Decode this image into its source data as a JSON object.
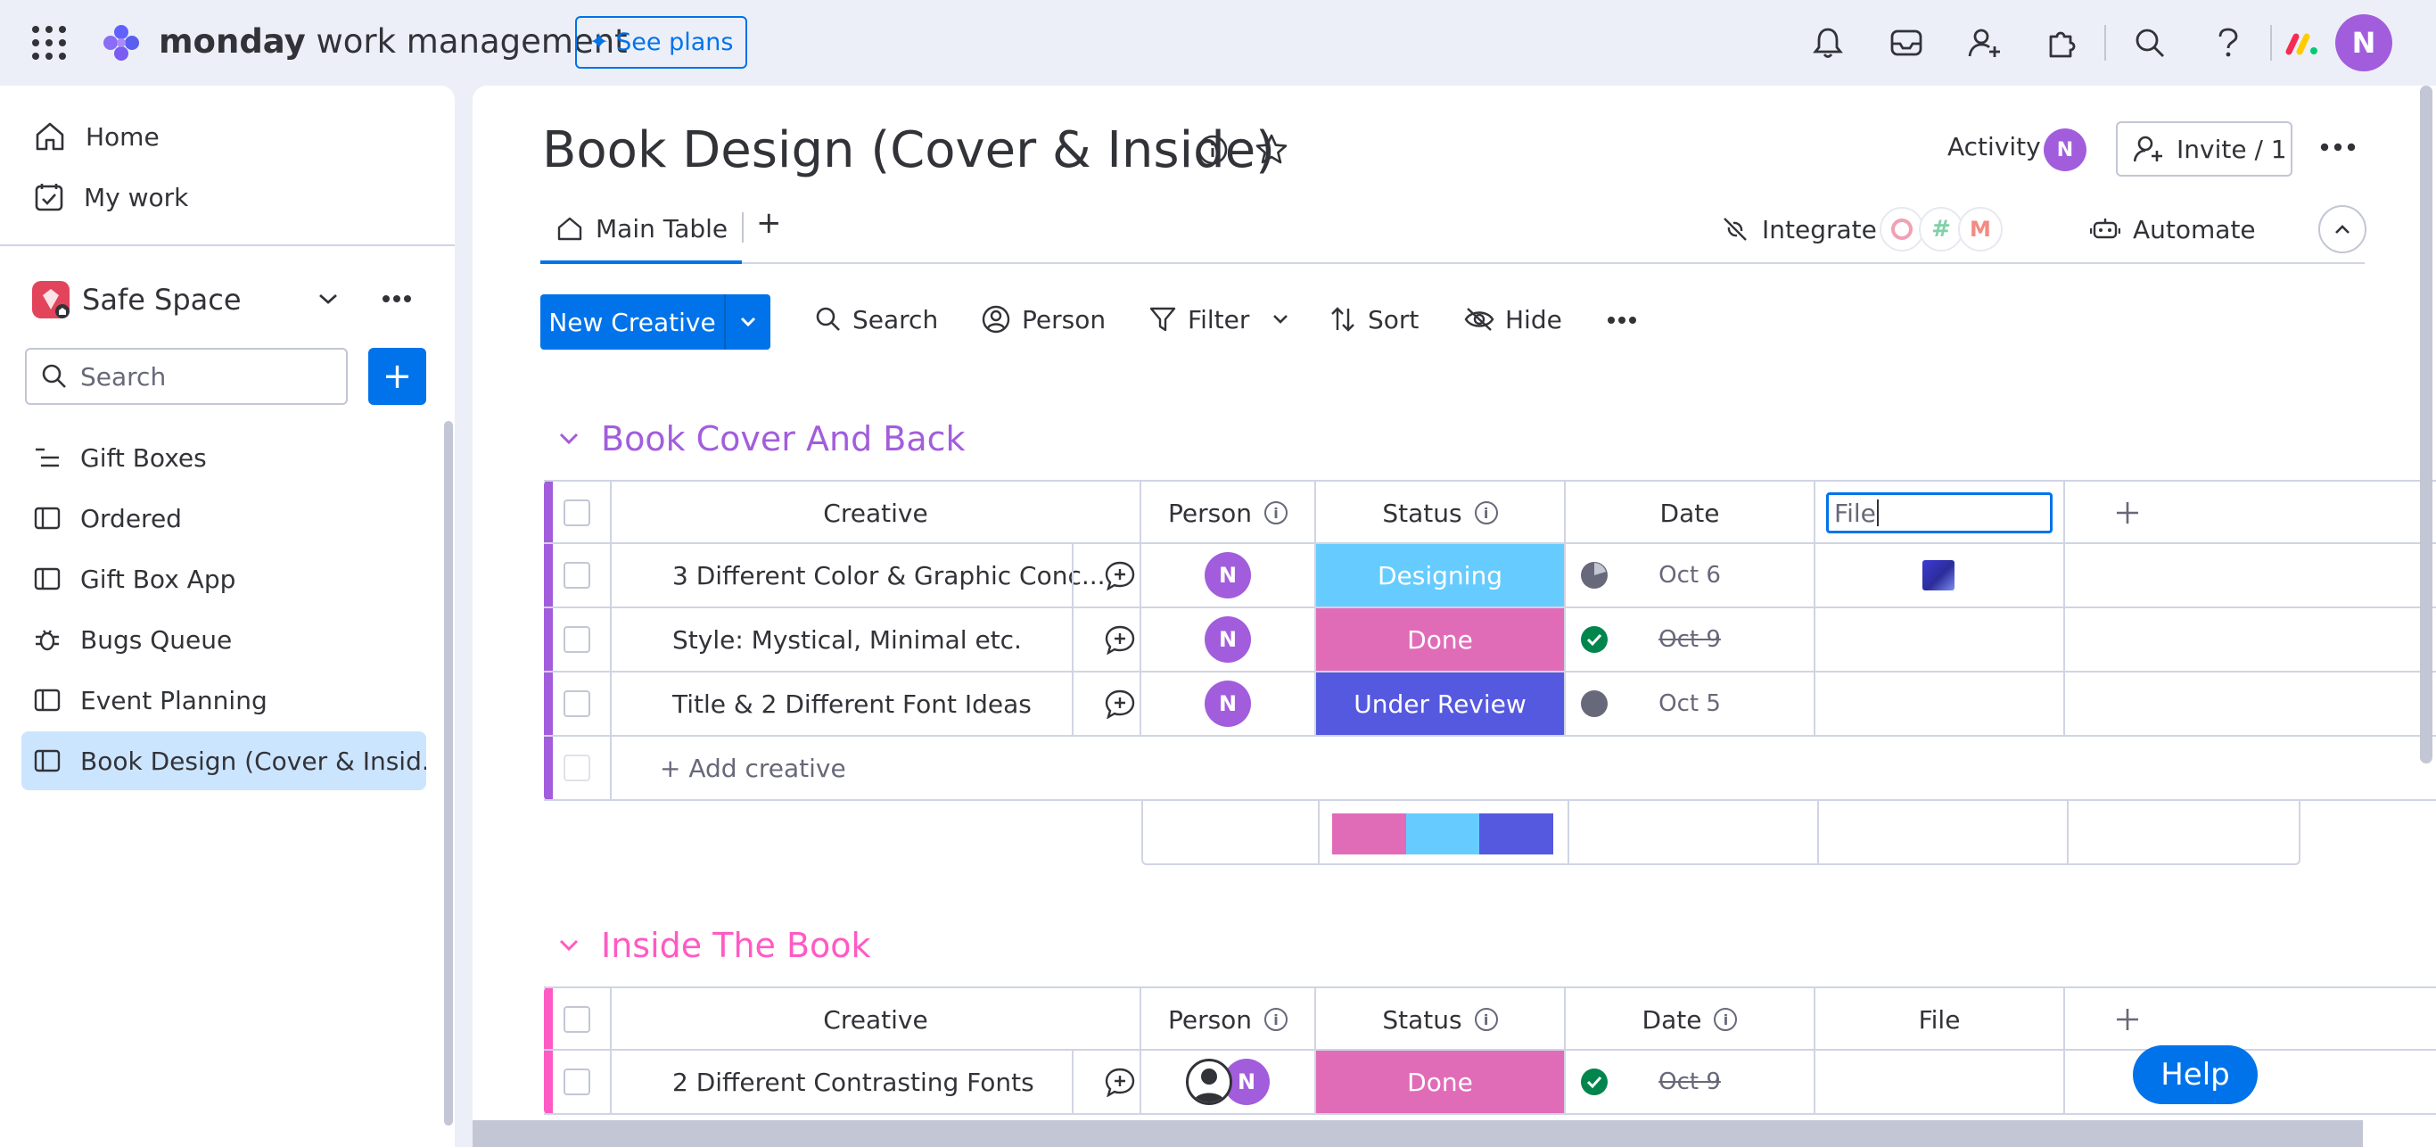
{
  "app": {
    "brand_bold": "monday",
    "brand_rest": " work management",
    "see_plans": "See plans",
    "user_initial": "N"
  },
  "sidebar": {
    "items": [
      {
        "label": "Home",
        "icon": "home-icon"
      },
      {
        "label": "My work",
        "icon": "my-work-icon"
      }
    ],
    "workspace": "Safe Space",
    "search_placeholder": "Search",
    "boards": [
      {
        "label": "Gift Boxes",
        "icon": "list-icon"
      },
      {
        "label": "Ordered",
        "icon": "board-icon"
      },
      {
        "label": "Gift Box App",
        "icon": "board-icon"
      },
      {
        "label": "Bugs Queue",
        "icon": "bug-icon"
      },
      {
        "label": "Event Planning",
        "icon": "board-icon"
      },
      {
        "label": "Book Design (Cover & Insid...",
        "icon": "board-icon",
        "active": true
      }
    ]
  },
  "board": {
    "title": "Book Design (Cover & Inside)",
    "activity": "Activity",
    "invite": "Invite / 1",
    "tab": "Main Table",
    "integrate": "Integrate",
    "automate": "Automate"
  },
  "toolbar": {
    "new_item": "New Creative",
    "search": "Search",
    "person": "Person",
    "filter": "Filter",
    "sort": "Sort",
    "hide": "Hide"
  },
  "colors": {
    "group1": "#a25ddc",
    "group2": "#ff5ac4",
    "designing": "#66ccff",
    "done": "#e06cb8",
    "under_review": "#5559df",
    "accent": "#0073ea"
  },
  "groups": [
    {
      "title": "Book Cover And Back",
      "columns": {
        "name": "Creative",
        "person": "Person",
        "status": "Status",
        "date": "Date",
        "file": "File"
      },
      "rows": [
        {
          "name": "3 Different Color & Graphic Conc...",
          "person": "N",
          "status": "Designing",
          "date": "Oct 6"
        },
        {
          "name": "Style: Mystical, Minimal etc.",
          "person": "N",
          "status": "Done",
          "date": "Oct 9"
        },
        {
          "name": "Title & 2 Different Font Ideas",
          "person": "N",
          "status": "Under Review",
          "date": "Oct 5"
        }
      ],
      "add_label": "+ Add creative"
    },
    {
      "title": "Inside The Book",
      "columns": {
        "name": "Creative",
        "person": "Person",
        "status": "Status",
        "date": "Date",
        "file": "File"
      },
      "rows": [
        {
          "name": "2 Different Contrasting Fonts",
          "person": "N",
          "status": "Done",
          "date": "Oct 9"
        }
      ]
    }
  ],
  "help": "Help"
}
